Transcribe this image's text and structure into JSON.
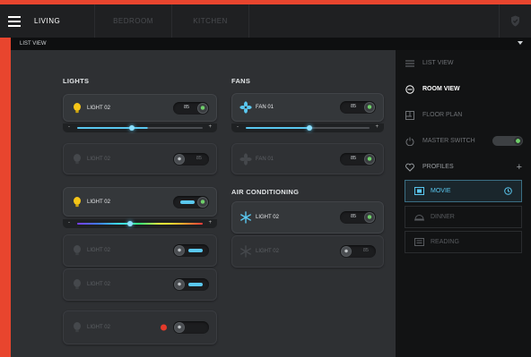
{
  "header": {
    "tabs": [
      {
        "label": "LIVING",
        "active": true
      },
      {
        "label": "BEDROOM",
        "active": false
      },
      {
        "label": "KITCHEN",
        "active": false
      }
    ]
  },
  "subbar": {
    "label": "LIST VIEW"
  },
  "lights": {
    "title": "LIGHTS",
    "items": [
      {
        "label": "LIGHT 02",
        "value": "85",
        "state": "on"
      },
      {
        "label": "LIGHT 02",
        "value": "85",
        "state": "off"
      },
      {
        "label": "LIGHT 02",
        "state": "on"
      },
      {
        "label": "LIGHT 02",
        "state": "off"
      },
      {
        "label": "LIGHT 02",
        "state": "off"
      },
      {
        "label": "LIGHT 02",
        "state": "off",
        "alert": true
      }
    ]
  },
  "fans": {
    "title": "FANS",
    "items": [
      {
        "label": "FAN 01",
        "value": "85",
        "state": "on"
      },
      {
        "label": "FAN 01",
        "value": "85",
        "state": "off"
      }
    ]
  },
  "ac": {
    "title": "AIR CONDITIONING",
    "items": [
      {
        "label": "LIGHT 02",
        "value": "85",
        "state": "on"
      },
      {
        "label": "LIGHT 02",
        "value": "85",
        "state": "off"
      }
    ]
  },
  "sidebar": {
    "items": [
      {
        "label": "LIST VIEW"
      },
      {
        "label": "ROOM VIEW"
      },
      {
        "label": "FLOOR PLAN"
      },
      {
        "label": "MASTER SWITCH"
      },
      {
        "label": "PROFILES"
      }
    ],
    "profiles": [
      {
        "label": "MOVIE",
        "active": true
      },
      {
        "label": "DINNER",
        "active": false
      },
      {
        "label": "READING",
        "active": false
      }
    ]
  },
  "colors": {
    "accent": "#5ac8f0",
    "on": "#6fd06a",
    "brand": "#e8452e",
    "bulb": "#f5c518"
  }
}
